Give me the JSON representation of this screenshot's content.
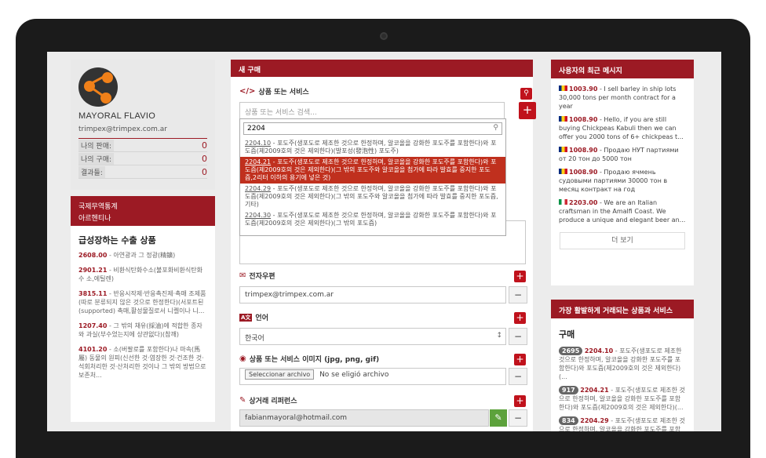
{
  "profile": {
    "name": "MAYORAL FLAVIO",
    "email": "trimpex@trimpex.com.ar",
    "stats": [
      {
        "label": "나의 판매:",
        "value": "0"
      },
      {
        "label": "나의 구매:",
        "value": "0"
      },
      {
        "label": "결과들:",
        "value": "0"
      }
    ]
  },
  "stats_box": {
    "title": "국제무역통계",
    "country": "아르헨티나"
  },
  "trending": {
    "title": "급성장하는 수출 상품",
    "items": [
      {
        "code": "2608.00",
        "text": " - 아연광과 그 정광(精鑛)"
      },
      {
        "code": "2901.21",
        "text": " - 비환식탄화수소(불포화비환식탄화수 소,에틸렌)"
      },
      {
        "code": "3815.11",
        "text": " - 반응시작제·반응촉진제·촉매 조제품(따로 분류되지 않은 것으로 한정한다)(서포트된(supported) 촉매,활성물질로서 니켈이나 니..."
      },
      {
        "code": "1207.40",
        "text": " - 그 밖의 채유(採油)에 적합한 종자와 과실(부수었는지에 상관없다)(참깨)"
      },
      {
        "code": "4101.20",
        "text": " - 소(버팔로를 포함한다)나 마속(馬屬) 동물의 원피(신선한 것·염장한 것·건조한 것·석회처리한 것·산처리한 것이나 그 밖의 방법으로 보존처..."
      }
    ]
  },
  "form": {
    "title": "새 구매",
    "product_label": "상품 또는 서비스",
    "product_placeholder": "상품 또는 서비스 검색...",
    "search_value": "2204",
    "options": [
      {
        "code": "2204.10",
        "text": " - 포도주(생포도로 제조한 것으로 한정하며, 알코올을 강화한 포도주를 포함한다)와 포도즙(제2009호의 것은 제외한다)(발포성(發泡性) 포도주)"
      },
      {
        "code": "2204.21",
        "text": " - 포도주(생포도로 제조한 것으로 한정하며, 알코올을 강화한 포도주를 포함한다)와 포도즙(제2009호의 것은 제외한다)(그 밖의 포도주와 알코올을 첨가에 따라 발효를 중지한 포도즙,2리터 이하의 용기에 넣은 것)"
      },
      {
        "code": "2204.29",
        "text": " - 포도주(생포도로 제조한 것으로 한정하며, 알코올을 강화한 포도주를 포함한다)와 포도즙(제2009호의 것은 제외한다)(그 밖의 포도주와 알코올을 첨가에 따라 발효를 중지한 포도즙,기타)"
      },
      {
        "code": "2204.30",
        "text": " - 포도주(생포도로 제조한 것으로 한정하며, 알코올을 강화한 포도주를 포함한다)와 포도즙(제2009호의 것은 제외한다)(그 밖의 포도즙)"
      }
    ],
    "email_label": "전자우편",
    "email_value": "trimpex@trimpex.com.ar",
    "language_label": "언어",
    "language_value": "한국어",
    "image_label": "상품 또는 서비스 이미지 (jpg, png, gif)",
    "file_button": "Seleccionar archivo",
    "file_status": "No se eligió archivo",
    "reference_label": "상거래 리퍼런스",
    "reference_value": "fabianmayoral@hotmail.com"
  },
  "messages": {
    "title": "사용자의 최근 메시지",
    "items": [
      {
        "flag": "ro",
        "num": "1003.90",
        "text": " - I sell barley in ship lots 30,000 tons per month contract for a year"
      },
      {
        "flag": "ro",
        "num": "1008.90",
        "text": " - Hello, if you are still buying Chickpeas Kabuli then we can offer you 2000 tons of 6+ chickpeas t..."
      },
      {
        "flag": "ro",
        "num": "1008.90",
        "text": " - Продаю НУТ партиями от 20 тон до 5000 тон"
      },
      {
        "flag": "ro",
        "num": "1008.90",
        "text": " - Продаю ячмень судовыми партиями 30000 тон в месяц контракт на год"
      },
      {
        "flag": "it",
        "num": "2203.00",
        "text": " - We are an Italian craftsman in the Amalfi Coast. We produce a unique and elegant beer an..."
      }
    ],
    "more": "더 보기"
  },
  "top_products": {
    "title": "가장 활발하게 거래되는 상품과 서비스",
    "category": "구매",
    "items": [
      {
        "count": "2695",
        "code": "2204.10",
        "text": " - 포도주(생포도로 제조한 것으로 한정하며, 알코올을 강화한 포도주를 포함한다)와 포도즙(제2009호의 것은 제외한다)(..."
      },
      {
        "count": "917",
        "code": "2204.21",
        "text": " - 포도주(생포도로 제조한 것으로 한정하며, 알코올을 강화한 포도주를 포함한다)와 포도즙(제2009호의 것은 제외한다)(..."
      },
      {
        "count": "834",
        "code": "2204.29",
        "text": " - 포도주(생포도로 제조한 것으로 한정하며, 알코올을 강화한 포도주를 포함한다)와 포도즙(제2009호의 것은 제외한다)(..."
      }
    ]
  },
  "colors": {
    "brand": "#9c1a24",
    "accent": "#c0121c",
    "ok": "#5da23c"
  }
}
